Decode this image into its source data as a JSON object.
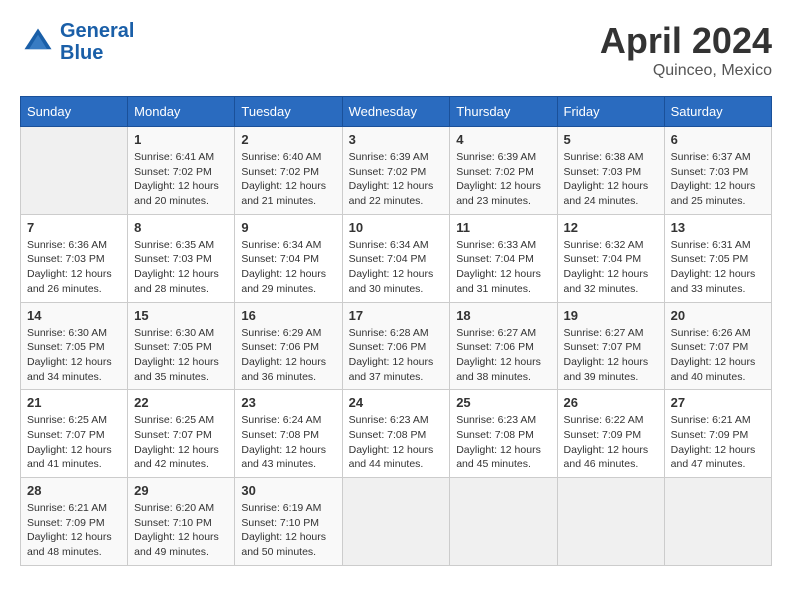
{
  "header": {
    "logo_line1": "General",
    "logo_line2": "Blue",
    "title": "April 2024",
    "subtitle": "Quinceo, Mexico"
  },
  "days_of_week": [
    "Sunday",
    "Monday",
    "Tuesday",
    "Wednesday",
    "Thursday",
    "Friday",
    "Saturday"
  ],
  "weeks": [
    [
      {
        "num": "",
        "info": ""
      },
      {
        "num": "1",
        "info": "Sunrise: 6:41 AM\nSunset: 7:02 PM\nDaylight: 12 hours\nand 20 minutes."
      },
      {
        "num": "2",
        "info": "Sunrise: 6:40 AM\nSunset: 7:02 PM\nDaylight: 12 hours\nand 21 minutes."
      },
      {
        "num": "3",
        "info": "Sunrise: 6:39 AM\nSunset: 7:02 PM\nDaylight: 12 hours\nand 22 minutes."
      },
      {
        "num": "4",
        "info": "Sunrise: 6:39 AM\nSunset: 7:02 PM\nDaylight: 12 hours\nand 23 minutes."
      },
      {
        "num": "5",
        "info": "Sunrise: 6:38 AM\nSunset: 7:03 PM\nDaylight: 12 hours\nand 24 minutes."
      },
      {
        "num": "6",
        "info": "Sunrise: 6:37 AM\nSunset: 7:03 PM\nDaylight: 12 hours\nand 25 minutes."
      }
    ],
    [
      {
        "num": "7",
        "info": "Sunrise: 6:36 AM\nSunset: 7:03 PM\nDaylight: 12 hours\nand 26 minutes."
      },
      {
        "num": "8",
        "info": "Sunrise: 6:35 AM\nSunset: 7:03 PM\nDaylight: 12 hours\nand 28 minutes."
      },
      {
        "num": "9",
        "info": "Sunrise: 6:34 AM\nSunset: 7:04 PM\nDaylight: 12 hours\nand 29 minutes."
      },
      {
        "num": "10",
        "info": "Sunrise: 6:34 AM\nSunset: 7:04 PM\nDaylight: 12 hours\nand 30 minutes."
      },
      {
        "num": "11",
        "info": "Sunrise: 6:33 AM\nSunset: 7:04 PM\nDaylight: 12 hours\nand 31 minutes."
      },
      {
        "num": "12",
        "info": "Sunrise: 6:32 AM\nSunset: 7:04 PM\nDaylight: 12 hours\nand 32 minutes."
      },
      {
        "num": "13",
        "info": "Sunrise: 6:31 AM\nSunset: 7:05 PM\nDaylight: 12 hours\nand 33 minutes."
      }
    ],
    [
      {
        "num": "14",
        "info": "Sunrise: 6:30 AM\nSunset: 7:05 PM\nDaylight: 12 hours\nand 34 minutes."
      },
      {
        "num": "15",
        "info": "Sunrise: 6:30 AM\nSunset: 7:05 PM\nDaylight: 12 hours\nand 35 minutes."
      },
      {
        "num": "16",
        "info": "Sunrise: 6:29 AM\nSunset: 7:06 PM\nDaylight: 12 hours\nand 36 minutes."
      },
      {
        "num": "17",
        "info": "Sunrise: 6:28 AM\nSunset: 7:06 PM\nDaylight: 12 hours\nand 37 minutes."
      },
      {
        "num": "18",
        "info": "Sunrise: 6:27 AM\nSunset: 7:06 PM\nDaylight: 12 hours\nand 38 minutes."
      },
      {
        "num": "19",
        "info": "Sunrise: 6:27 AM\nSunset: 7:07 PM\nDaylight: 12 hours\nand 39 minutes."
      },
      {
        "num": "20",
        "info": "Sunrise: 6:26 AM\nSunset: 7:07 PM\nDaylight: 12 hours\nand 40 minutes."
      }
    ],
    [
      {
        "num": "21",
        "info": "Sunrise: 6:25 AM\nSunset: 7:07 PM\nDaylight: 12 hours\nand 41 minutes."
      },
      {
        "num": "22",
        "info": "Sunrise: 6:25 AM\nSunset: 7:07 PM\nDaylight: 12 hours\nand 42 minutes."
      },
      {
        "num": "23",
        "info": "Sunrise: 6:24 AM\nSunset: 7:08 PM\nDaylight: 12 hours\nand 43 minutes."
      },
      {
        "num": "24",
        "info": "Sunrise: 6:23 AM\nSunset: 7:08 PM\nDaylight: 12 hours\nand 44 minutes."
      },
      {
        "num": "25",
        "info": "Sunrise: 6:23 AM\nSunset: 7:08 PM\nDaylight: 12 hours\nand 45 minutes."
      },
      {
        "num": "26",
        "info": "Sunrise: 6:22 AM\nSunset: 7:09 PM\nDaylight: 12 hours\nand 46 minutes."
      },
      {
        "num": "27",
        "info": "Sunrise: 6:21 AM\nSunset: 7:09 PM\nDaylight: 12 hours\nand 47 minutes."
      }
    ],
    [
      {
        "num": "28",
        "info": "Sunrise: 6:21 AM\nSunset: 7:09 PM\nDaylight: 12 hours\nand 48 minutes."
      },
      {
        "num": "29",
        "info": "Sunrise: 6:20 AM\nSunset: 7:10 PM\nDaylight: 12 hours\nand 49 minutes."
      },
      {
        "num": "30",
        "info": "Sunrise: 6:19 AM\nSunset: 7:10 PM\nDaylight: 12 hours\nand 50 minutes."
      },
      {
        "num": "",
        "info": ""
      },
      {
        "num": "",
        "info": ""
      },
      {
        "num": "",
        "info": ""
      },
      {
        "num": "",
        "info": ""
      }
    ]
  ]
}
